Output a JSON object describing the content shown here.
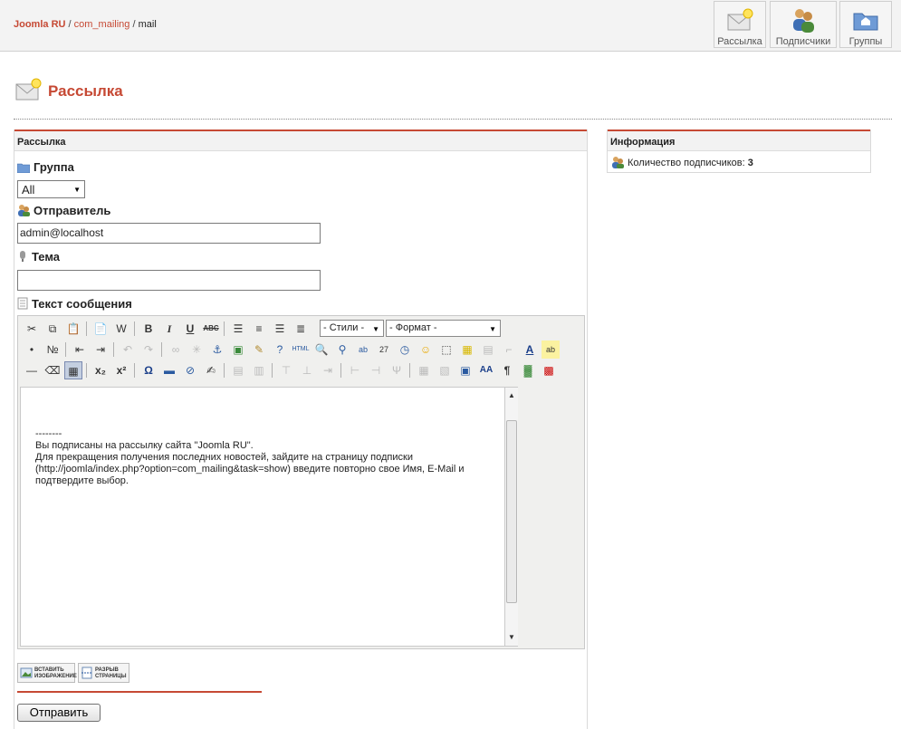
{
  "breadcrumb": {
    "root": "Joomla RU",
    "component": "com_mailing",
    "current": "mail",
    "separator": "/"
  },
  "toolbar": {
    "mailing_label": "Рассылка",
    "subscribers_label": "Подписчики",
    "groups_label": "Группы"
  },
  "page": {
    "title": "Рассылка"
  },
  "form": {
    "panel_title": "Рассылка",
    "group_label": "Группа",
    "group_value": "All",
    "sender_label": "Отправитель",
    "sender_value": "admin@localhost",
    "subject_label": "Тема",
    "subject_value": "",
    "message_label": "Текст сообщения",
    "submit_label": "Отправить"
  },
  "editor": {
    "styles_select": "- Стили -",
    "format_select": "- Формат -",
    "content": {
      "line1": "--------",
      "line2": "Вы подписаны на рассылку сайта \"Joomla RU\".",
      "line3": "Для прекращения получения последних новостей, зайдите на страницу подписки",
      "line4": "(http://joomla/index.php?option=com_mailing&task=show) введите повторно свое Имя, E-Mail и",
      "line5": "подтвердите выбор."
    },
    "insert_image_label_1": "ВСТАВИТЬ",
    "insert_image_label_2": "ИЗОБРАЖЕНИЕ",
    "page_break_label_1": "РАЗРЫВ",
    "page_break_label_2": "СТРАНИЦЫ"
  },
  "info": {
    "title": "Информация",
    "subscribers_text": "Количество подписчиков:",
    "subscribers_count": "3"
  },
  "colors": {
    "accent": "#c64934",
    "panel_bg": "#f2f2f2",
    "toolbar_bg": "#f0f0ee"
  }
}
